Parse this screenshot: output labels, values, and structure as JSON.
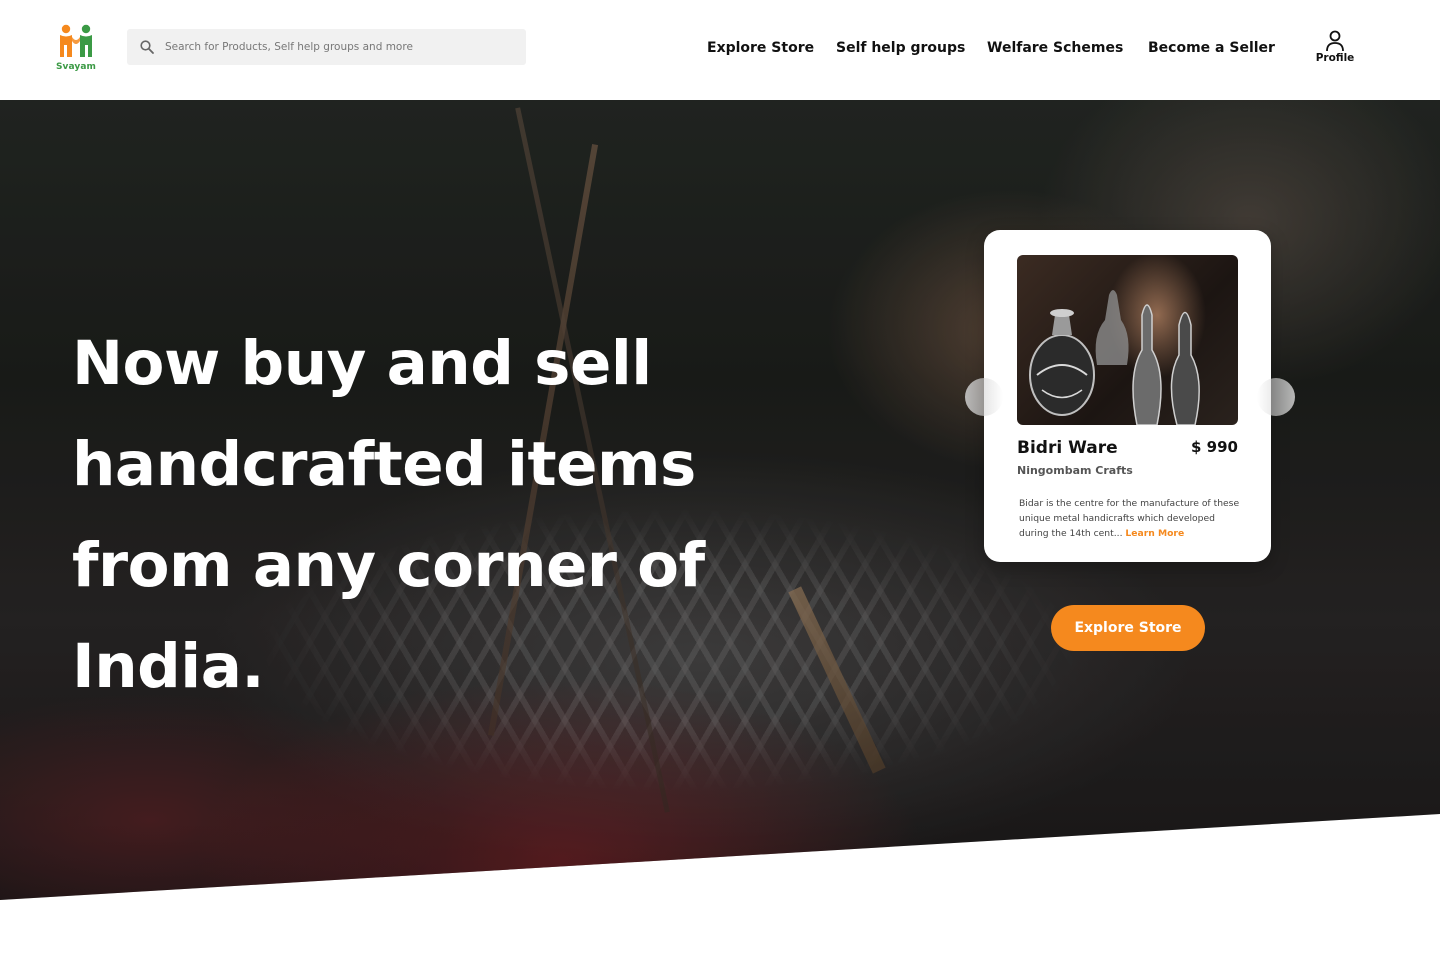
{
  "brand": {
    "name": "Svayam",
    "colors": {
      "orange": "#f5891e",
      "green": "#3b9a45"
    }
  },
  "search": {
    "placeholder": "Search for Products, Self help groups and more",
    "value": "",
    "icon": "search-icon"
  },
  "nav": {
    "items": [
      {
        "label": "Explore Store"
      },
      {
        "label": "Self help groups"
      },
      {
        "label": "Welfare Schemes"
      },
      {
        "label": "Become a Seller"
      }
    ],
    "profile": {
      "label": "Profile",
      "icon": "user-icon"
    }
  },
  "hero": {
    "headline_lines": [
      "Now buy and sell",
      "handcrafted items",
      "from any corner of",
      "India."
    ],
    "cta_label": "Explore Store"
  },
  "product_card": {
    "title": "Bidri Ware",
    "price": "$ 990",
    "seller": "Ningombam Crafts",
    "description": "Bidar is the centre for the manufacture of these unique metal handicrafts which developed during the 14th cent...",
    "link_label": "Learn More",
    "prev_icon": "chevron-left-icon",
    "next_icon": "chevron-right-icon"
  }
}
